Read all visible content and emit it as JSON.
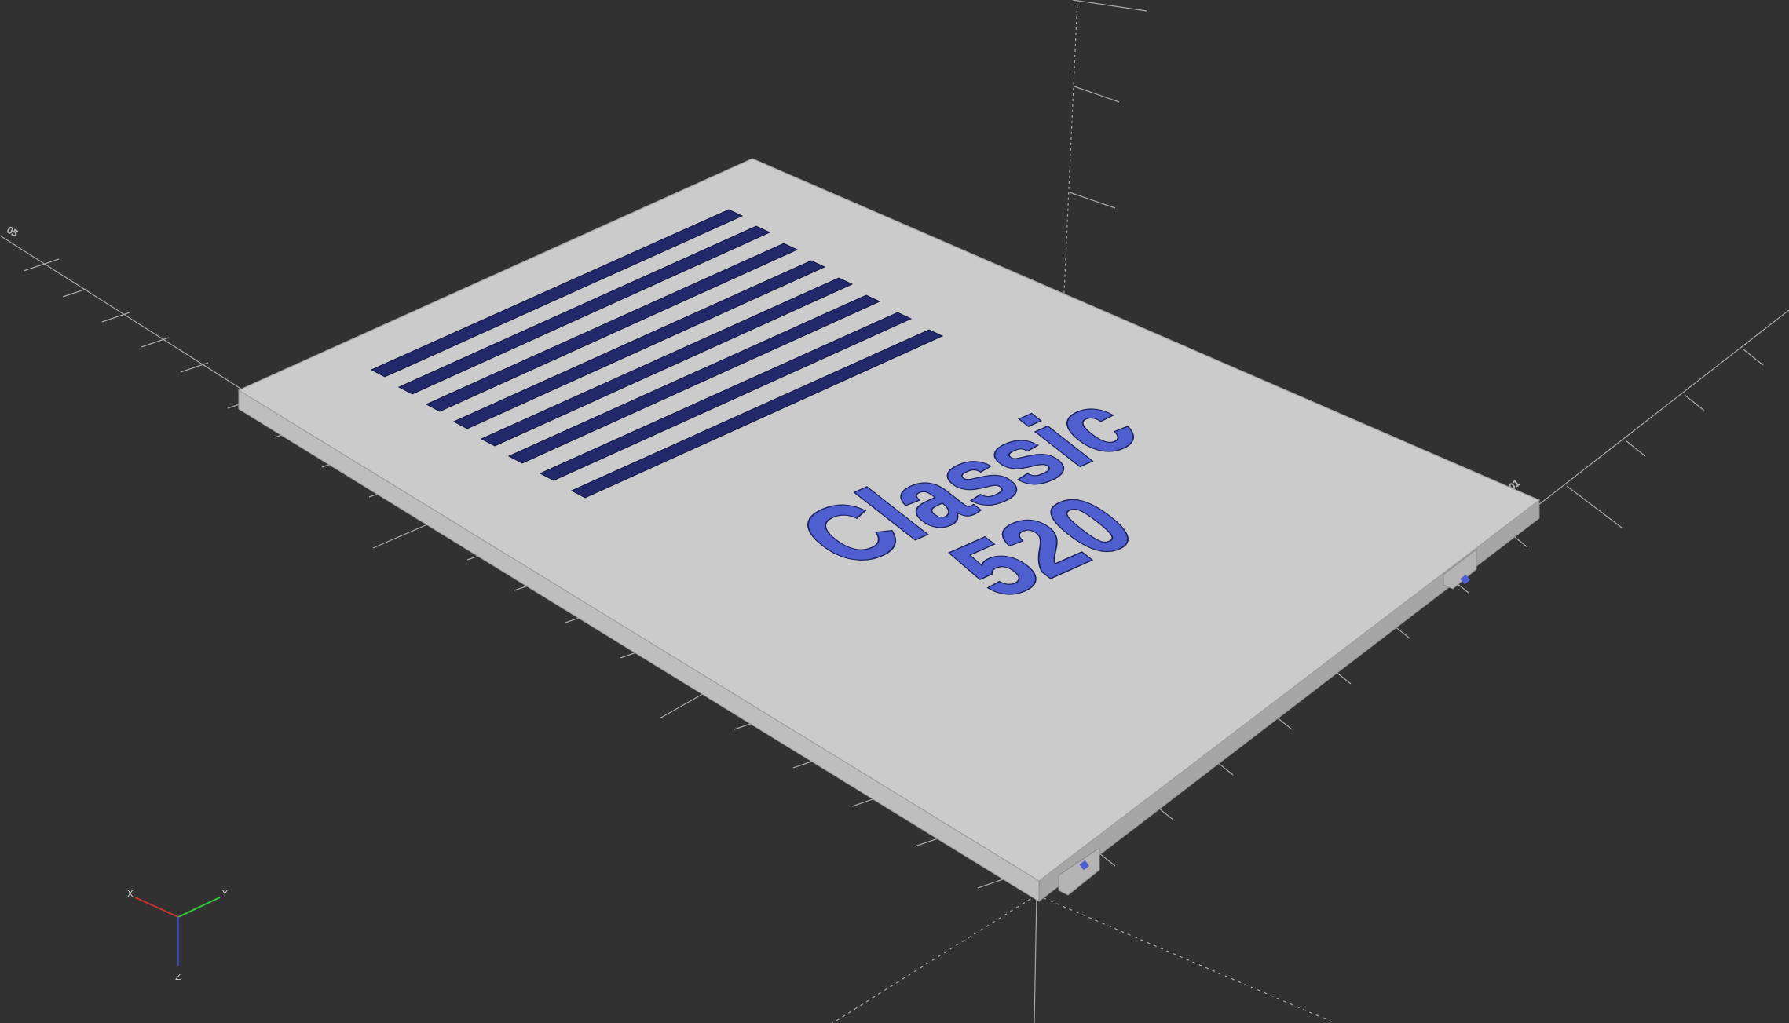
{
  "viewport": {
    "background": "#313131",
    "model": {
      "engraved_text_line1": "Classic",
      "engraved_text_line2": "520",
      "top_color": "#cbcbcb",
      "front_side_color": "#b8b8b8",
      "right_side_color": "#a9a9a9",
      "slot_color": "#22296a",
      "text_color": "#4f5fd0",
      "vent_slot_count": 8
    },
    "axes_gizmo": {
      "x_label": "X",
      "y_label": "Y",
      "z_label": "Z",
      "x_color": "#c83232",
      "y_color": "#32c832",
      "z_color": "#3246c8"
    },
    "axis_scale_labels": {
      "left": "05",
      "right": "01"
    }
  }
}
